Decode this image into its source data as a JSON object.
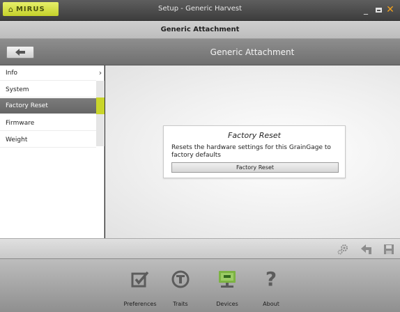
{
  "window": {
    "brand": "MIRUS",
    "title": "Setup - Generic Harvest",
    "controls": {
      "minimize": "_",
      "close": "✕"
    }
  },
  "subtitle": "Generic Attachment",
  "header": {
    "title": "Generic Attachment",
    "back_icon": "back-arrow-icon"
  },
  "sidebar": {
    "items": [
      {
        "label": "Info"
      },
      {
        "label": "System"
      },
      {
        "label": "Factory Reset",
        "selected": true
      },
      {
        "label": "Firmware"
      },
      {
        "label": "Weight"
      }
    ],
    "chevron": "›",
    "accent_color": "#c9d52a"
  },
  "card": {
    "title": "Factory Reset",
    "description": "Resets the hardware settings for this GrainGage to factory defaults",
    "button_label": "Factory Reset"
  },
  "actionbar": {
    "icons": [
      "settings-gears-icon",
      "undo-icon",
      "save-disk-icon"
    ]
  },
  "bottom_nav": {
    "items": [
      {
        "label": "Preferences",
        "icon": "checkbox-icon"
      },
      {
        "label": "Traits",
        "icon": "traits-t-icon"
      },
      {
        "label": "Devices",
        "icon": "device-monitor-icon",
        "active": true
      },
      {
        "label": "About",
        "icon": "question-mark-icon"
      }
    ]
  }
}
